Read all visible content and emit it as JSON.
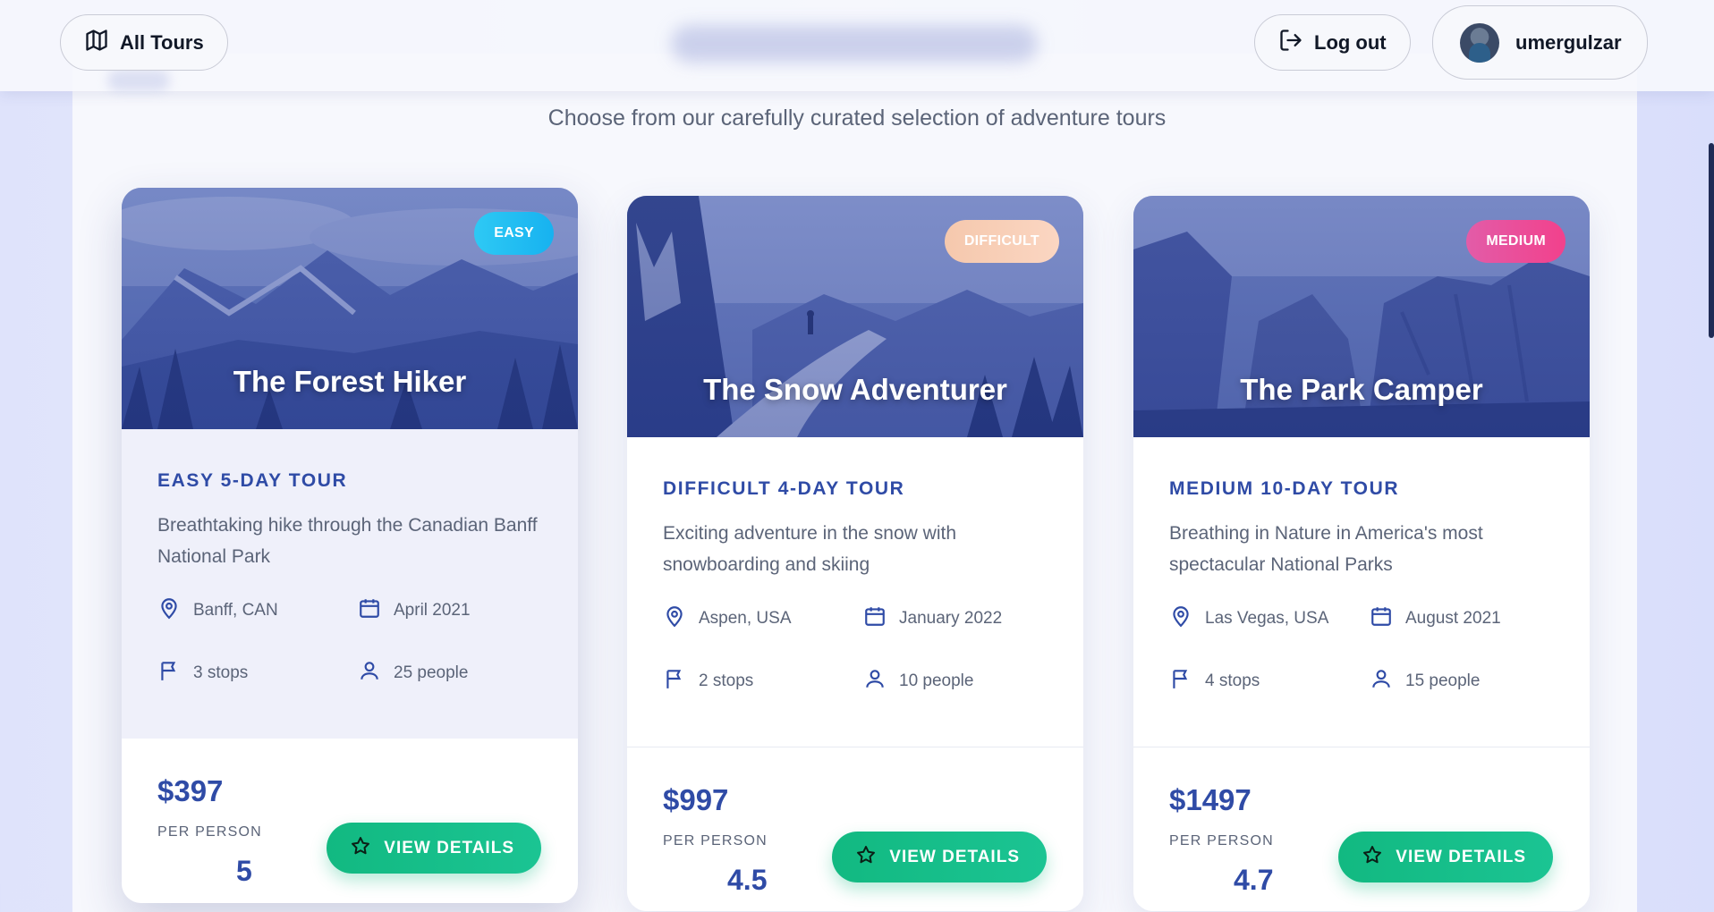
{
  "header": {
    "all_tours_label": "All Tours",
    "logout_label": "Log out",
    "username": "umergulzar"
  },
  "subtitle": "Choose from our carefully curated selection of adventure tours",
  "tours": [
    {
      "title": "The Forest Hiker",
      "badge": "EASY",
      "type": "EASY 5-DAY TOUR",
      "description": "Breathtaking hike through the Canadian Banff National Park",
      "location": "Banff, CAN",
      "date": "April 2021",
      "stops": "3 stops",
      "people": "25 people",
      "price": "$397",
      "per": "PER PERSON",
      "rating": "5",
      "button": "VIEW DETAILS"
    },
    {
      "title": "The Snow Adventurer",
      "badge": "DIFFICULT",
      "type": "DIFFICULT 4-DAY TOUR",
      "description": "Exciting adventure in the snow with snowboarding and skiing",
      "location": "Aspen, USA",
      "date": "January 2022",
      "stops": "2 stops",
      "people": "10 people",
      "price": "$997",
      "per": "PER PERSON",
      "rating": "4.5",
      "button": "VIEW DETAILS"
    },
    {
      "title": "The Park Camper",
      "badge": "MEDIUM",
      "type": "MEDIUM 10-DAY TOUR",
      "description": "Breathing in Nature in America's most spectacular National Parks",
      "location": "Las Vegas, USA",
      "date": "August 2021",
      "stops": "4 stops",
      "people": "15 people",
      "price": "$1497",
      "per": "PER PERSON",
      "rating": "4.7",
      "button": "VIEW DETAILS"
    }
  ],
  "colors": {
    "accent": "#2f4ba6",
    "button_green": "#12b981",
    "badge_easy": "#17b2f0",
    "badge_difficult": "#f5c8ad",
    "badge_medium": "#f2418c"
  },
  "icons": [
    "map-icon",
    "logout-icon",
    "location-pin-icon",
    "calendar-icon",
    "flag-icon",
    "person-icon",
    "star-icon"
  ]
}
